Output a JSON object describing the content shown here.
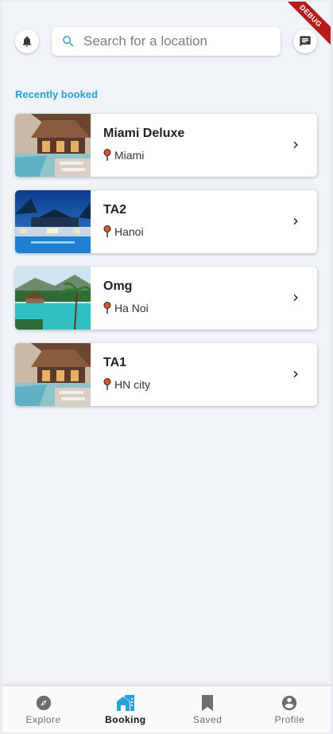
{
  "header": {
    "search_placeholder": "Search for a location",
    "debug_banner": "DEBUG"
  },
  "section_title": "Recently booked",
  "bookings": [
    {
      "name": "Miami Deluxe",
      "location": "Miami",
      "thumb": "resort-bungalow"
    },
    {
      "name": "TA2",
      "location": "Hanoi",
      "thumb": "pool-dusk"
    },
    {
      "name": "Omg",
      "location": "Ha Noi",
      "thumb": "tropical-pool"
    },
    {
      "name": "TA1",
      "location": "HN city",
      "thumb": "resort-bungalow"
    }
  ],
  "nav": [
    {
      "label": "Explore",
      "icon": "compass-icon",
      "active": false
    },
    {
      "label": "Booking",
      "icon": "home-work-icon",
      "active": true
    },
    {
      "label": "Saved",
      "icon": "bookmark-icon",
      "active": false
    },
    {
      "label": "Profile",
      "icon": "account-circle-icon",
      "active": false
    }
  ],
  "colors": {
    "accent": "#2a9fd8",
    "background": "#f0f3f8",
    "pin": "#d9582b",
    "debug": "#b71c1c"
  }
}
